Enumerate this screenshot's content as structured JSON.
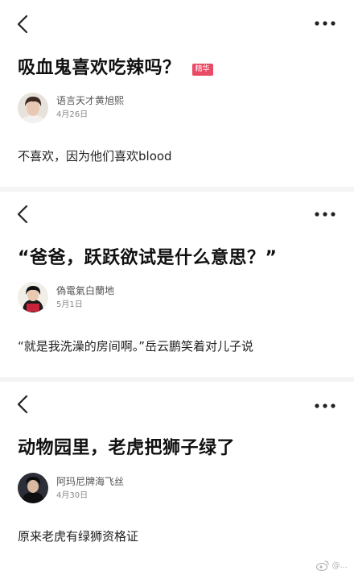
{
  "posts": [
    {
      "title": "吸血鬼喜欢吃辣吗？",
      "badge": "精华",
      "author": "语言天才黄旭熙",
      "date": "4月26日",
      "body": "不喜欢，因为他们喜欢blood"
    },
    {
      "title": "“爸爸，跃跃欲试是什么意思？”",
      "author": "偽電氣白蘭地",
      "date": "5月1日",
      "body": "“就是我洗澡的房间啊。”岳云鹏笑着对儿子说"
    },
    {
      "title": "动物园里，老虎把狮子绿了",
      "author": "阿玛尼牌海飞丝",
      "date": "4月30日",
      "body": "原来老虎有绿狮资格证"
    }
  ],
  "icons": {
    "back": "chevron-left-icon",
    "more": "more-horizontal-icon"
  },
  "colors": {
    "badge": "#e94a65",
    "separator": "#f4f4f4"
  },
  "watermark": "@..."
}
